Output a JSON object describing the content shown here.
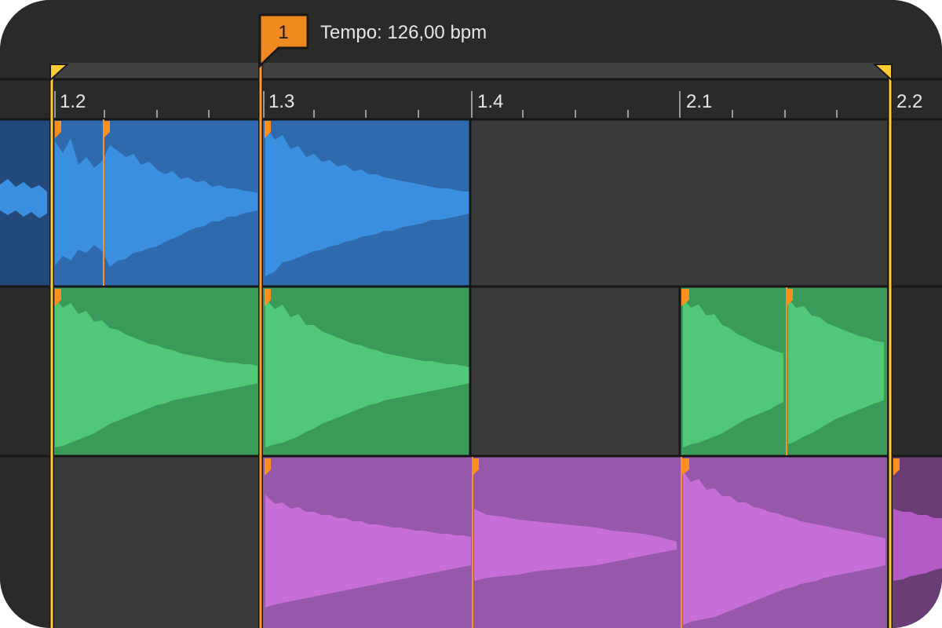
{
  "header": {
    "marker_number": "1",
    "tempo_text": "Tempo: 126,00 bpm"
  },
  "ruler": {
    "labels": [
      "1.2",
      "1.3",
      "1.4",
      "2.1",
      "2.2"
    ]
  },
  "colors": {
    "background": "#2a2a2a",
    "lane_empty": "#3a3a3a",
    "separator": "#161616",
    "loop_brace": "#ffcc33",
    "playhead": "#ff9926",
    "warp_marker": "#ff9020",
    "track_blue_clip": "#2e6aad",
    "track_blue_wave": "#3b8fe0",
    "track_green_clip": "#3a9a5a",
    "track_green_wave": "#50c878",
    "track_purple_clip": "#9658a8",
    "track_purple_wave": "#c66fd8"
  },
  "tracks": [
    {
      "name": "",
      "color": "blue"
    },
    {
      "name": "",
      "color": "green"
    },
    {
      "name": "",
      "color": "purple"
    }
  ],
  "icons": {
    "locator": "flag-marker-icon",
    "loop_start": "loop-start-triangle-icon",
    "loop_end": "loop-end-triangle-icon",
    "warp": "warp-marker-icon"
  }
}
